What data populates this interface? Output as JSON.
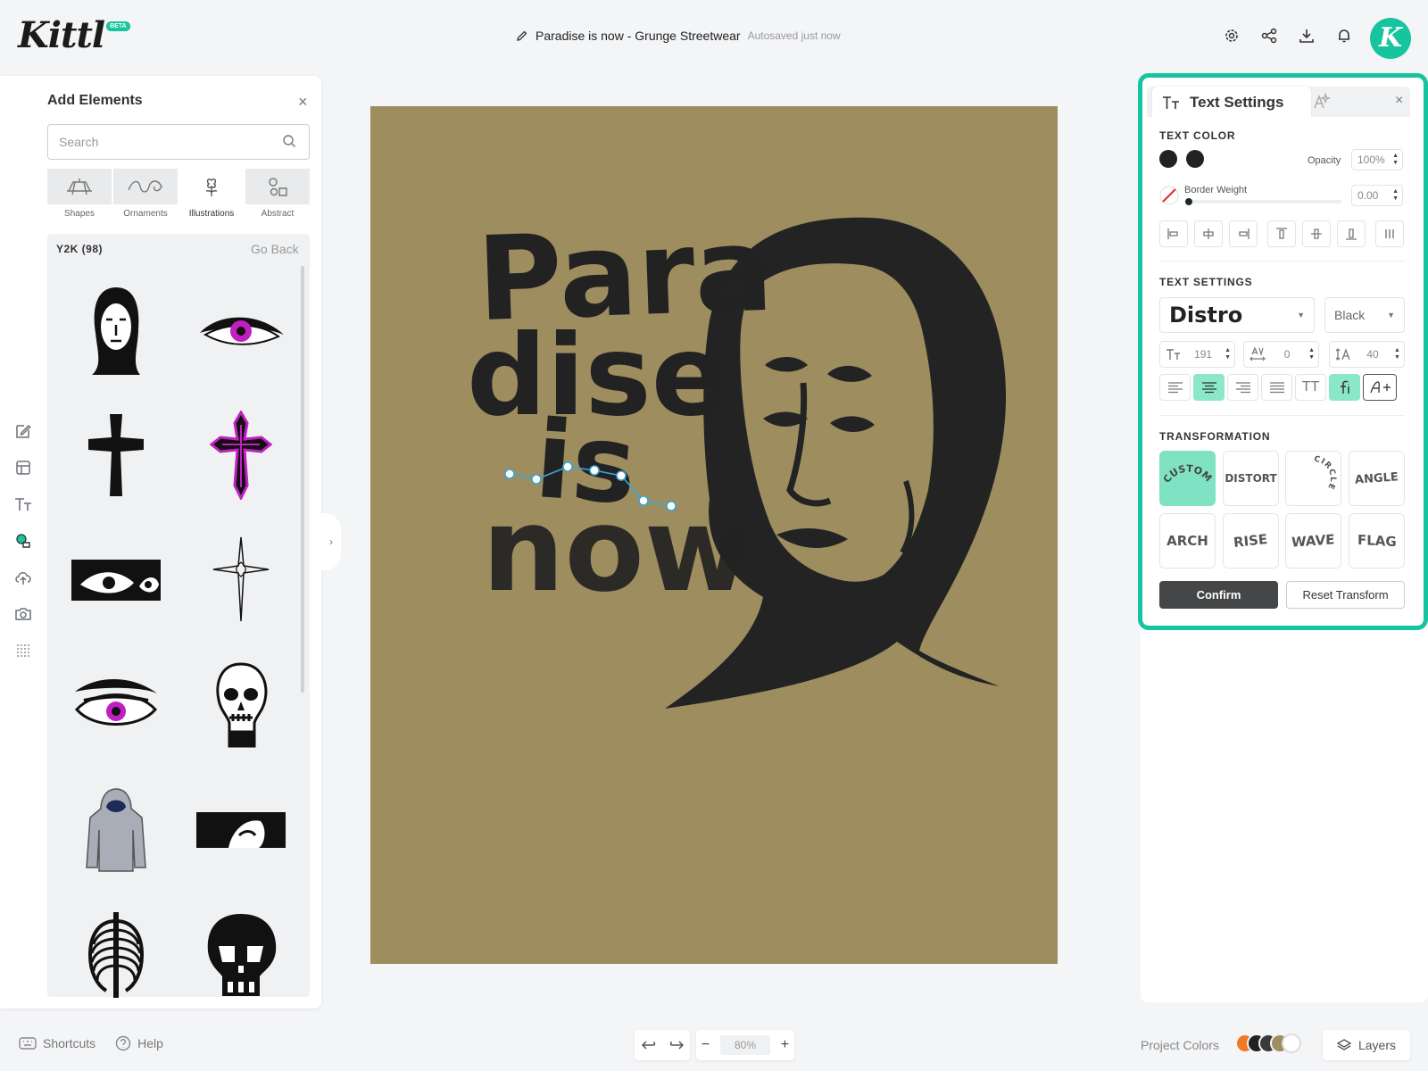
{
  "app": {
    "logo": "Kittl",
    "beta": "BETA",
    "avatar_letter": "K"
  },
  "document": {
    "title": "Paradise is now - Grunge Streetwear",
    "autosave": "Autosaved just now"
  },
  "add_elements": {
    "title": "Add Elements",
    "search_placeholder": "Search",
    "categories": [
      {
        "label": "Shapes"
      },
      {
        "label": "Ornaments"
      },
      {
        "label": "Illustrations"
      },
      {
        "label": "Abstract"
      }
    ],
    "collection": "Y2K (98)",
    "go_back": "Go Back"
  },
  "canvas": {
    "background": "#9d8d5f",
    "lines": [
      "Para",
      "dise",
      "is",
      "now"
    ]
  },
  "text_settings": {
    "tab_label": "Text Settings",
    "color_section": "TEXT COLOR",
    "opacity_label": "Opacity",
    "opacity_value": "100%",
    "border_weight_label": "Border Weight",
    "border_weight_value": "0.00",
    "settings_section": "TEXT SETTINGS",
    "font": "Distro",
    "weight": "Black",
    "font_size": "191",
    "letter_spacing": "0",
    "line_height": "40",
    "case_label": "TT",
    "transform_section": "TRANSFORMATION",
    "transforms": [
      "CUSTOM",
      "DISTORT",
      "CIRCLE",
      "ANGLE",
      "ARCH",
      "RISE",
      "WAVE",
      "FLAG"
    ],
    "confirm": "Confirm",
    "reset": "Reset Transform"
  },
  "bottom": {
    "shortcuts": "Shortcuts",
    "help": "Help",
    "zoom": "80%",
    "project_colors": "Project Colors",
    "project_color_swatches": [
      "#f07a22",
      "#222222",
      "#3a3a3a",
      "#9d8d5f"
    ],
    "layers": "Layers"
  },
  "colors": {
    "accent": "#15c4a0",
    "ink": "#222222"
  }
}
